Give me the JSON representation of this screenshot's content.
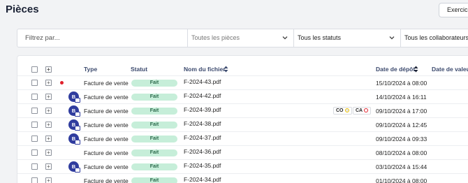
{
  "header": {
    "title": "Pièces",
    "exercise_button": "Exercice"
  },
  "filters": {
    "search_placeholder": "Filtrez par...",
    "pieces_select": "Toutes les pièces",
    "status_select": "Tous les statuts",
    "collaborators_select": "Tous les collaborateurs"
  },
  "table": {
    "columns": {
      "type": "Type",
      "status": "Statut",
      "filename": "Nom du fichier",
      "deposit_date": "Date de dépôt",
      "value_date": "Date de valeur"
    },
    "rows": [
      {
        "type": "Facture de vente",
        "status": "Fait",
        "file": "F-2024-43.pdf",
        "date": "15/10/2024 à 08:00",
        "flag": true,
        "avatar": false
      },
      {
        "type": "Facture de vente",
        "status": "Fait",
        "file": "F-2024-42.pdf",
        "date": "14/10/2024 à 16:11",
        "flag": false,
        "avatar": true,
        "initials": "B"
      },
      {
        "type": "Facture de vente",
        "status": "Fait",
        "file": "F-2024-39.pdf",
        "date": "09/10/2024 à 17:00",
        "flag": false,
        "avatar": true,
        "initials": "B",
        "chips": [
          {
            "label": "CO",
            "color": "#e8e8e8",
            "ring": "#f0c400"
          },
          {
            "label": "CA",
            "color": "#ffffff",
            "ring": "#e0202b"
          }
        ]
      },
      {
        "type": "Facture de vente",
        "status": "Fait",
        "file": "F-2024-38.pdf",
        "date": "09/10/2024 à 12:45",
        "flag": false,
        "avatar": true,
        "initials": "B"
      },
      {
        "type": "Facture de vente",
        "status": "Fait",
        "file": "F-2024-37.pdf",
        "date": "09/10/2024 à 09:33",
        "flag": false,
        "avatar": true,
        "initials": "B"
      },
      {
        "type": "Facture de vente",
        "status": "Fait",
        "file": "F-2024-36.pdf",
        "date": "08/10/2024 à 08:00",
        "flag": false,
        "avatar": false
      },
      {
        "type": "Facture de vente",
        "status": "Fait",
        "file": "F-2024-35.pdf",
        "date": "03/10/2024 à 15:44",
        "flag": false,
        "avatar": true,
        "initials": "B"
      },
      {
        "type": "Facture de vente",
        "status": "Fait",
        "file": "F-2024-34.pdf",
        "date": "01/10/2024 à 08:00",
        "flag": false,
        "avatar": false
      }
    ]
  },
  "colors": {
    "status_badge_bg": "#c6eed9",
    "avatar_bg": "#2f3c9e",
    "flag_red": "#e0202b",
    "header_text": "#3c4a6e"
  }
}
